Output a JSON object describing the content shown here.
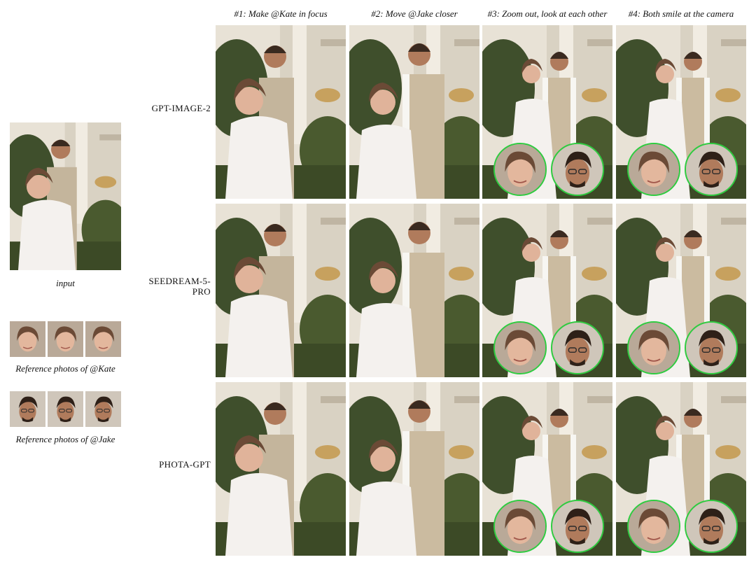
{
  "columns": [
    "#1: Make @Kate in focus",
    "#2: Move @Jake closer",
    "#3: Zoom out, look at each other",
    "#4: Both smile at the camera"
  ],
  "rows": [
    "GPT-IMAGE-2",
    "SEEDREAM-5-PRO",
    "PHOTA-GPT"
  ],
  "row_label_lines": [
    [
      "GPT-IMAGE-2"
    ],
    [
      "SEEDREAM-5-",
      "PRO"
    ],
    [
      "PHOTA-GPT"
    ]
  ],
  "input_caption": "input",
  "kate_ref_caption": "Reference photos of @Kate",
  "jake_ref_caption": "Reference photos of @Jake",
  "colors": {
    "inset_ring": "#2ecc40"
  },
  "icons": [
    "face-inset"
  ]
}
